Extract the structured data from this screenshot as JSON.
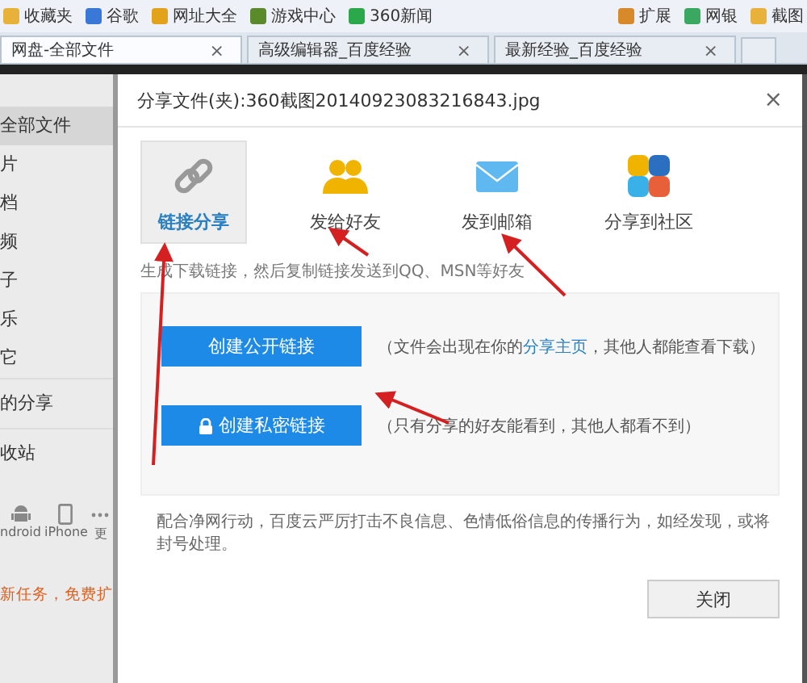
{
  "bookmarks": {
    "items": [
      {
        "label": "收藏夹",
        "kind": "folder"
      },
      {
        "label": "谷歌",
        "kind": "search"
      },
      {
        "label": "网址大全",
        "kind": "globe"
      },
      {
        "label": "游戏中心",
        "kind": "game"
      },
      {
        "label": "360新闻",
        "kind": "news"
      }
    ],
    "right": [
      {
        "label": "扩展",
        "kind": "grid"
      },
      {
        "label": "网银",
        "kind": "bank"
      },
      {
        "label": "截图",
        "kind": "shot"
      }
    ]
  },
  "tabs": [
    {
      "label": "网盘-全部文件",
      "selected": true,
      "close": "×"
    },
    {
      "label": "高级编辑器_百度经验",
      "selected": false,
      "close": "×"
    },
    {
      "label": "最新经验_百度经验",
      "selected": false,
      "close": "×"
    }
  ],
  "sidebar": {
    "items": [
      {
        "label": "全部文件",
        "selected": true
      },
      {
        "label": "片",
        "selected": false
      },
      {
        "label": "档",
        "selected": false
      },
      {
        "label": "频",
        "selected": false
      },
      {
        "label": "子",
        "selected": false
      },
      {
        "label": "乐",
        "selected": false
      },
      {
        "label": "它",
        "selected": false
      }
    ],
    "links": [
      "的分享",
      "收站"
    ],
    "devices": [
      {
        "label": "ndroid",
        "kind": "android"
      },
      {
        "label": "iPhone",
        "kind": "phone"
      },
      {
        "label": "更",
        "kind": "more"
      }
    ],
    "promo": "新任务，免费扩"
  },
  "dialog": {
    "title": "分享文件(夹):360截图20140923083216843.jpg",
    "close": "×",
    "options": [
      {
        "label": "链接分享",
        "kind": "link",
        "selected": true
      },
      {
        "label": "发给好友",
        "kind": "friends",
        "selected": false
      },
      {
        "label": "发到邮箱",
        "kind": "mail",
        "selected": false
      },
      {
        "label": "分享到社区",
        "kind": "community",
        "selected": false
      }
    ],
    "description": "生成下载链接，然后复制链接发送到QQ、MSN等好友",
    "actions": [
      {
        "label": "创建公开链接",
        "locked": false,
        "note": "（文件会出现在你的**分享主页**，其他人都能查看下载）"
      },
      {
        "label": "创建私密链接",
        "locked": true,
        "note": "（只有分享的好友能看到，其他人都看不到）"
      }
    ],
    "footer": "配合净网行动，百度云严厉打击不良信息、色情低俗信息的传播行为，如经发现，或将封号处理。",
    "button": "关闭"
  }
}
